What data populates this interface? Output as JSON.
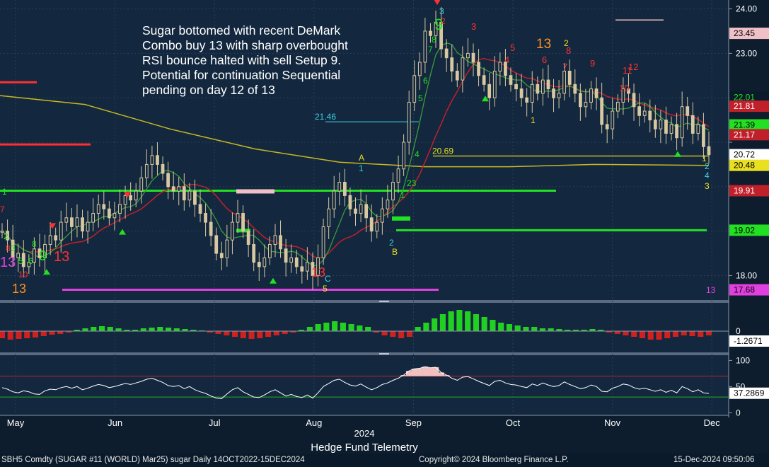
{
  "annotation": {
    "lines": [
      "Sugar bottomed with recent DeMark",
      "Combo buy 13 with sharp overbought",
      "RSI bounce halted with sell Setup 9.",
      "Potential for continuation Sequential",
      "pending on day 12 of 13"
    ]
  },
  "footer": {
    "security": "SBH5 Comdty (SUGAR #11 (WORLD) Mar25) sugar  Daily 14OCT2022-15DEC2024",
    "copyright": "Copyright© 2024 Bloomberg Finance L.P.",
    "timestamp": "15-Dec-2024 09:50:06",
    "credit": "Hedge Fund Telemetry"
  },
  "colors": {
    "background": "#0d1d2e",
    "candle": "#d8c8a0",
    "ma_short": "#3a9a3a",
    "ma_mid": "#c0202a",
    "ma_long": "#c8b820",
    "support": "#22e022",
    "hist_up": "#22d022",
    "hist_down": "#d02020",
    "rsi_line": "#ffffff",
    "overbought_fill": "#f0c0c0"
  },
  "chart_data": [
    {
      "type": "candlestick",
      "panel": "price",
      "x_labels": [
        "May",
        "Jun",
        "Jul",
        "Aug",
        "Sep",
        "Oct",
        "Nov",
        "Dec"
      ],
      "year_label": "2024",
      "y_ticks": [
        18.0,
        19.0,
        20.0,
        21.0,
        22.0,
        23.0,
        24.0
      ],
      "y_tick_labels": [
        "18.00",
        "",
        "",
        "",
        "",
        "23.00",
        "24.00"
      ],
      "ylim": [
        17.45,
        24.2
      ],
      "close_series": [
        19.0,
        18.8,
        18.4,
        18.5,
        18.2,
        18.3,
        18.6,
        18.4,
        18.7,
        18.9,
        18.8,
        19.2,
        19.3,
        19.1,
        19.3,
        19.0,
        19.2,
        19.4,
        19.6,
        19.5,
        19.3,
        19.4,
        19.6,
        19.8,
        19.7,
        19.9,
        20.2,
        20.5,
        20.7,
        20.5,
        20.3,
        20.0,
        19.9,
        20.0,
        19.7,
        19.9,
        19.6,
        19.4,
        19.2,
        18.9,
        18.5,
        18.4,
        18.8,
        19.2,
        19.4,
        19.0,
        18.7,
        18.3,
        18.2,
        18.4,
        18.7,
        18.9,
        18.6,
        18.3,
        18.4,
        18.2,
        18.1,
        18.3,
        18.0,
        18.4,
        19.1,
        19.5,
        19.9,
        20.1,
        19.8,
        19.5,
        19.4,
        19.6,
        19.3,
        19.0,
        19.2,
        19.5,
        19.7,
        20.1,
        20.4,
        21.0,
        21.9,
        22.5,
        22.8,
        23.5,
        23.4,
        23.7,
        23.1,
        22.9,
        22.6,
        22.4,
        22.9,
        23.0,
        22.8,
        22.5,
        22.3,
        22.0,
        22.6,
        22.8,
        22.5,
        22.3,
        22.2,
        22.0,
        21.9,
        22.3,
        22.1,
        22.4,
        22.2,
        22.0,
        22.1,
        22.6,
        22.3,
        22.1,
        21.8,
        21.9,
        22.2,
        22.0,
        21.4,
        21.3,
        21.7,
        21.9,
        22.2,
        22.1,
        21.8,
        21.6,
        21.7,
        21.5,
        21.3,
        21.5,
        21.2,
        21.4,
        21.1,
        21.8,
        21.6,
        21.2,
        21.4,
        20.9,
        20.72
      ],
      "last_price": "20.72",
      "price_tags": [
        {
          "label": "23.45",
          "value": 23.45,
          "color": "#f0c0c8",
          "text": "#000000"
        },
        {
          "label": "22.01",
          "value": 22.01,
          "color": "#0b1a2a",
          "text": "#22e022"
        },
        {
          "label": "21.81",
          "value": 21.81,
          "color": "#c0202a",
          "text": "#ffffff"
        },
        {
          "label": "21.39",
          "value": 21.39,
          "color": "#22e022",
          "text": "#000000"
        },
        {
          "label": "21.17",
          "value": 21.17,
          "color": "#c0202a",
          "text": "#ffffff"
        },
        {
          "label": "20.72",
          "value": 20.72,
          "color": "#ffffff",
          "text": "#000000"
        },
        {
          "label": "20.48",
          "value": 20.48,
          "color": "#e8e020",
          "text": "#000000"
        },
        {
          "label": "19.91",
          "value": 19.91,
          "color": "#c0202a",
          "text": "#ffffff"
        },
        {
          "label": "19.02",
          "value": 19.02,
          "color": "#22e022",
          "text": "#000000"
        },
        {
          "label": "17.68",
          "value": 17.68,
          "color": "#e040e0",
          "text": "#000000"
        }
      ],
      "level_labels": [
        {
          "label": "21.46",
          "value": 21.46,
          "color": "#40d0e0"
        },
        {
          "label": "20.69",
          "value": 20.69,
          "color": "#e8e020"
        }
      ],
      "demark_labels": [
        {
          "text": "13",
          "color": "#ff3030"
        },
        {
          "text": "9",
          "color": "#22e022"
        },
        {
          "text": "13",
          "color": "#e040e0"
        },
        {
          "text": "13",
          "color": "#ff9020"
        },
        {
          "text": "13",
          "color": "#ff3030"
        },
        {
          "text": "13",
          "color": "#e040e0"
        },
        {
          "text": "9",
          "color": "#22e022"
        },
        {
          "text": "13",
          "color": "#ff9020"
        },
        {
          "text": "3",
          "color": "#ff3030"
        },
        {
          "text": "5",
          "color": "#ff3030"
        },
        {
          "text": "4",
          "color": "#ff3030"
        },
        {
          "text": "6",
          "color": "#ff3030"
        },
        {
          "text": "7",
          "color": "#ff3030"
        },
        {
          "text": "8",
          "color": "#ff3030"
        },
        {
          "text": "9",
          "color": "#ff3030"
        },
        {
          "text": "10",
          "color": "#ff3030"
        },
        {
          "text": "11",
          "color": "#ff3030"
        },
        {
          "text": "12",
          "color": "#ff3030"
        },
        {
          "text": "A",
          "color": "#e8e020"
        },
        {
          "text": "B",
          "color": "#e8e020"
        },
        {
          "text": "C",
          "color": "#40d0e0"
        }
      ]
    },
    {
      "type": "bar",
      "panel": "histogram",
      "y_tick_labels": [
        "0"
      ],
      "last_value": "-1.2671",
      "values": [
        -0.5,
        -0.6,
        -0.55,
        -0.5,
        -0.45,
        -0.35,
        -0.25,
        -0.2,
        -0.1,
        0.1,
        0.2,
        0.3,
        0.35,
        0.3,
        0.2,
        0.1,
        0.1,
        0.2,
        0.25,
        0.3,
        0.25,
        0.2,
        0.15,
        0.1,
        0.05,
        -0.1,
        -0.2,
        -0.3,
        -0.4,
        -0.5,
        -0.55,
        -0.5,
        -0.4,
        -0.3,
        -0.2,
        -0.1,
        0.1,
        0.3,
        0.5,
        0.6,
        0.7,
        0.6,
        0.5,
        0.4,
        0.3,
        -0.1,
        -0.3,
        -0.4,
        -0.5,
        -0.4,
        0.3,
        0.6,
        0.9,
        1.2,
        1.4,
        1.5,
        1.4,
        1.2,
        1.0,
        0.8,
        0.6,
        0.5,
        0.4,
        0.3,
        0.3,
        0.2,
        0.2,
        0.15,
        0.1,
        0.1,
        0.1,
        0.15,
        0.1,
        -0.1,
        -0.2,
        -0.3,
        -0.4,
        -0.5,
        -0.6,
        -0.6,
        -0.5,
        -0.4,
        -0.3,
        -0.35,
        -0.4,
        -0.3
      ]
    },
    {
      "type": "line",
      "panel": "rsi",
      "y_ticks": [
        0,
        50,
        100
      ],
      "y_tick_labels": [
        "0",
        "50",
        "100"
      ],
      "ylim": [
        -5,
        110
      ],
      "overbought": 70,
      "oversold": 30,
      "last_value": "37.2869",
      "values": [
        48,
        45,
        40,
        38,
        42,
        40,
        36,
        35,
        42,
        45,
        44,
        48,
        50,
        47,
        50,
        44,
        47,
        51,
        54,
        52,
        48,
        50,
        53,
        56,
        54,
        57,
        60,
        64,
        66,
        62,
        58,
        52,
        50,
        52,
        46,
        50,
        44,
        40,
        37,
        32,
        28,
        27,
        36,
        44,
        48,
        40,
        35,
        30,
        29,
        34,
        40,
        44,
        38,
        32,
        35,
        31,
        29,
        34,
        28,
        38,
        50,
        56,
        62,
        64,
        58,
        53,
        51,
        55,
        49,
        44,
        48,
        54,
        57,
        62,
        66,
        72,
        80,
        84,
        85,
        88,
        86,
        87,
        77,
        72,
        66,
        62,
        68,
        69,
        65,
        60,
        56,
        52,
        60,
        62,
        57,
        54,
        53,
        50,
        48,
        55,
        52,
        57,
        53,
        50,
        52,
        59,
        54,
        50,
        46,
        48,
        53,
        50,
        41,
        40,
        47,
        50,
        55,
        53,
        48,
        45,
        47,
        44,
        41,
        44,
        39,
        43,
        38,
        50,
        46,
        40,
        44,
        38,
        37
      ]
    }
  ]
}
